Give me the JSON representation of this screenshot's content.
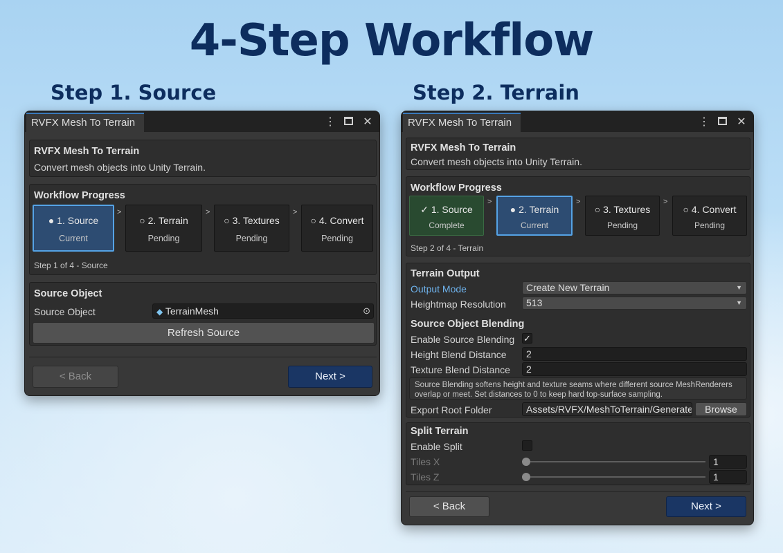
{
  "page_title": "4-Step Workflow",
  "left": {
    "heading": "Step 1. Source",
    "window_tab": "RVFX Mesh To Terrain",
    "header": {
      "title": "RVFX Mesh To Terrain",
      "desc": "Convert mesh objects into Unity Terrain."
    },
    "workflow": {
      "title": "Workflow Progress",
      "steps": [
        {
          "name": "1. Source",
          "status": "Current",
          "marker": "●"
        },
        {
          "name": "2. Terrain",
          "status": "Pending",
          "marker": "○"
        },
        {
          "name": "3. Textures",
          "status": "Pending",
          "marker": "○"
        },
        {
          "name": "4. Convert",
          "status": "Pending",
          "marker": "○"
        }
      ],
      "step_caption": "Step 1 of 4 - Source"
    },
    "source": {
      "title": "Source Object",
      "label": "Source Object",
      "value": "TerrainMesh",
      "refresh_label": "Refresh Source"
    },
    "nav": {
      "back": "< Back",
      "next": "Next >"
    }
  },
  "right": {
    "heading": "Step 2. Terrain",
    "window_tab": "RVFX Mesh To Terrain",
    "header": {
      "title": "RVFX Mesh To Terrain",
      "desc": "Convert mesh objects into Unity Terrain."
    },
    "workflow": {
      "title": "Workflow Progress",
      "steps": [
        {
          "name": "1. Source",
          "status": "Complete",
          "marker": "✓"
        },
        {
          "name": "2. Terrain",
          "status": "Current",
          "marker": "●"
        },
        {
          "name": "3. Textures",
          "status": "Pending",
          "marker": "○"
        },
        {
          "name": "4. Convert",
          "status": "Pending",
          "marker": "○"
        }
      ],
      "step_caption": "Step 2 of 4 - Terrain"
    },
    "terrain_output": {
      "title": "Terrain Output",
      "output_mode_label": "Output Mode",
      "output_mode_value": "Create New Terrain",
      "heightmap_label": "Heightmap Resolution",
      "heightmap_value": "513"
    },
    "blending": {
      "title": "Source Object Blending",
      "enable_label": "Enable Source Blending",
      "enable_checked": "✓",
      "height_label": "Height Blend Distance",
      "height_value": "2",
      "texture_label": "Texture Blend Distance",
      "texture_value": "2",
      "help": "Source Blending softens height and texture seams where different source MeshRenderers overlap or meet. Set distances to 0 to keep hard top-surface sampling.",
      "export_label": "Export Root Folder",
      "export_value": "Assets/RVFX/MeshToTerrain/Generated",
      "browse_label": "Browse"
    },
    "split": {
      "title": "Split Terrain",
      "enable_label": "Enable Split",
      "tiles_x_label": "Tiles X",
      "tiles_x_value": "1",
      "tiles_z_label": "Tiles Z",
      "tiles_z_value": "1"
    },
    "nav": {
      "back": "< Back",
      "next": "Next >"
    }
  }
}
